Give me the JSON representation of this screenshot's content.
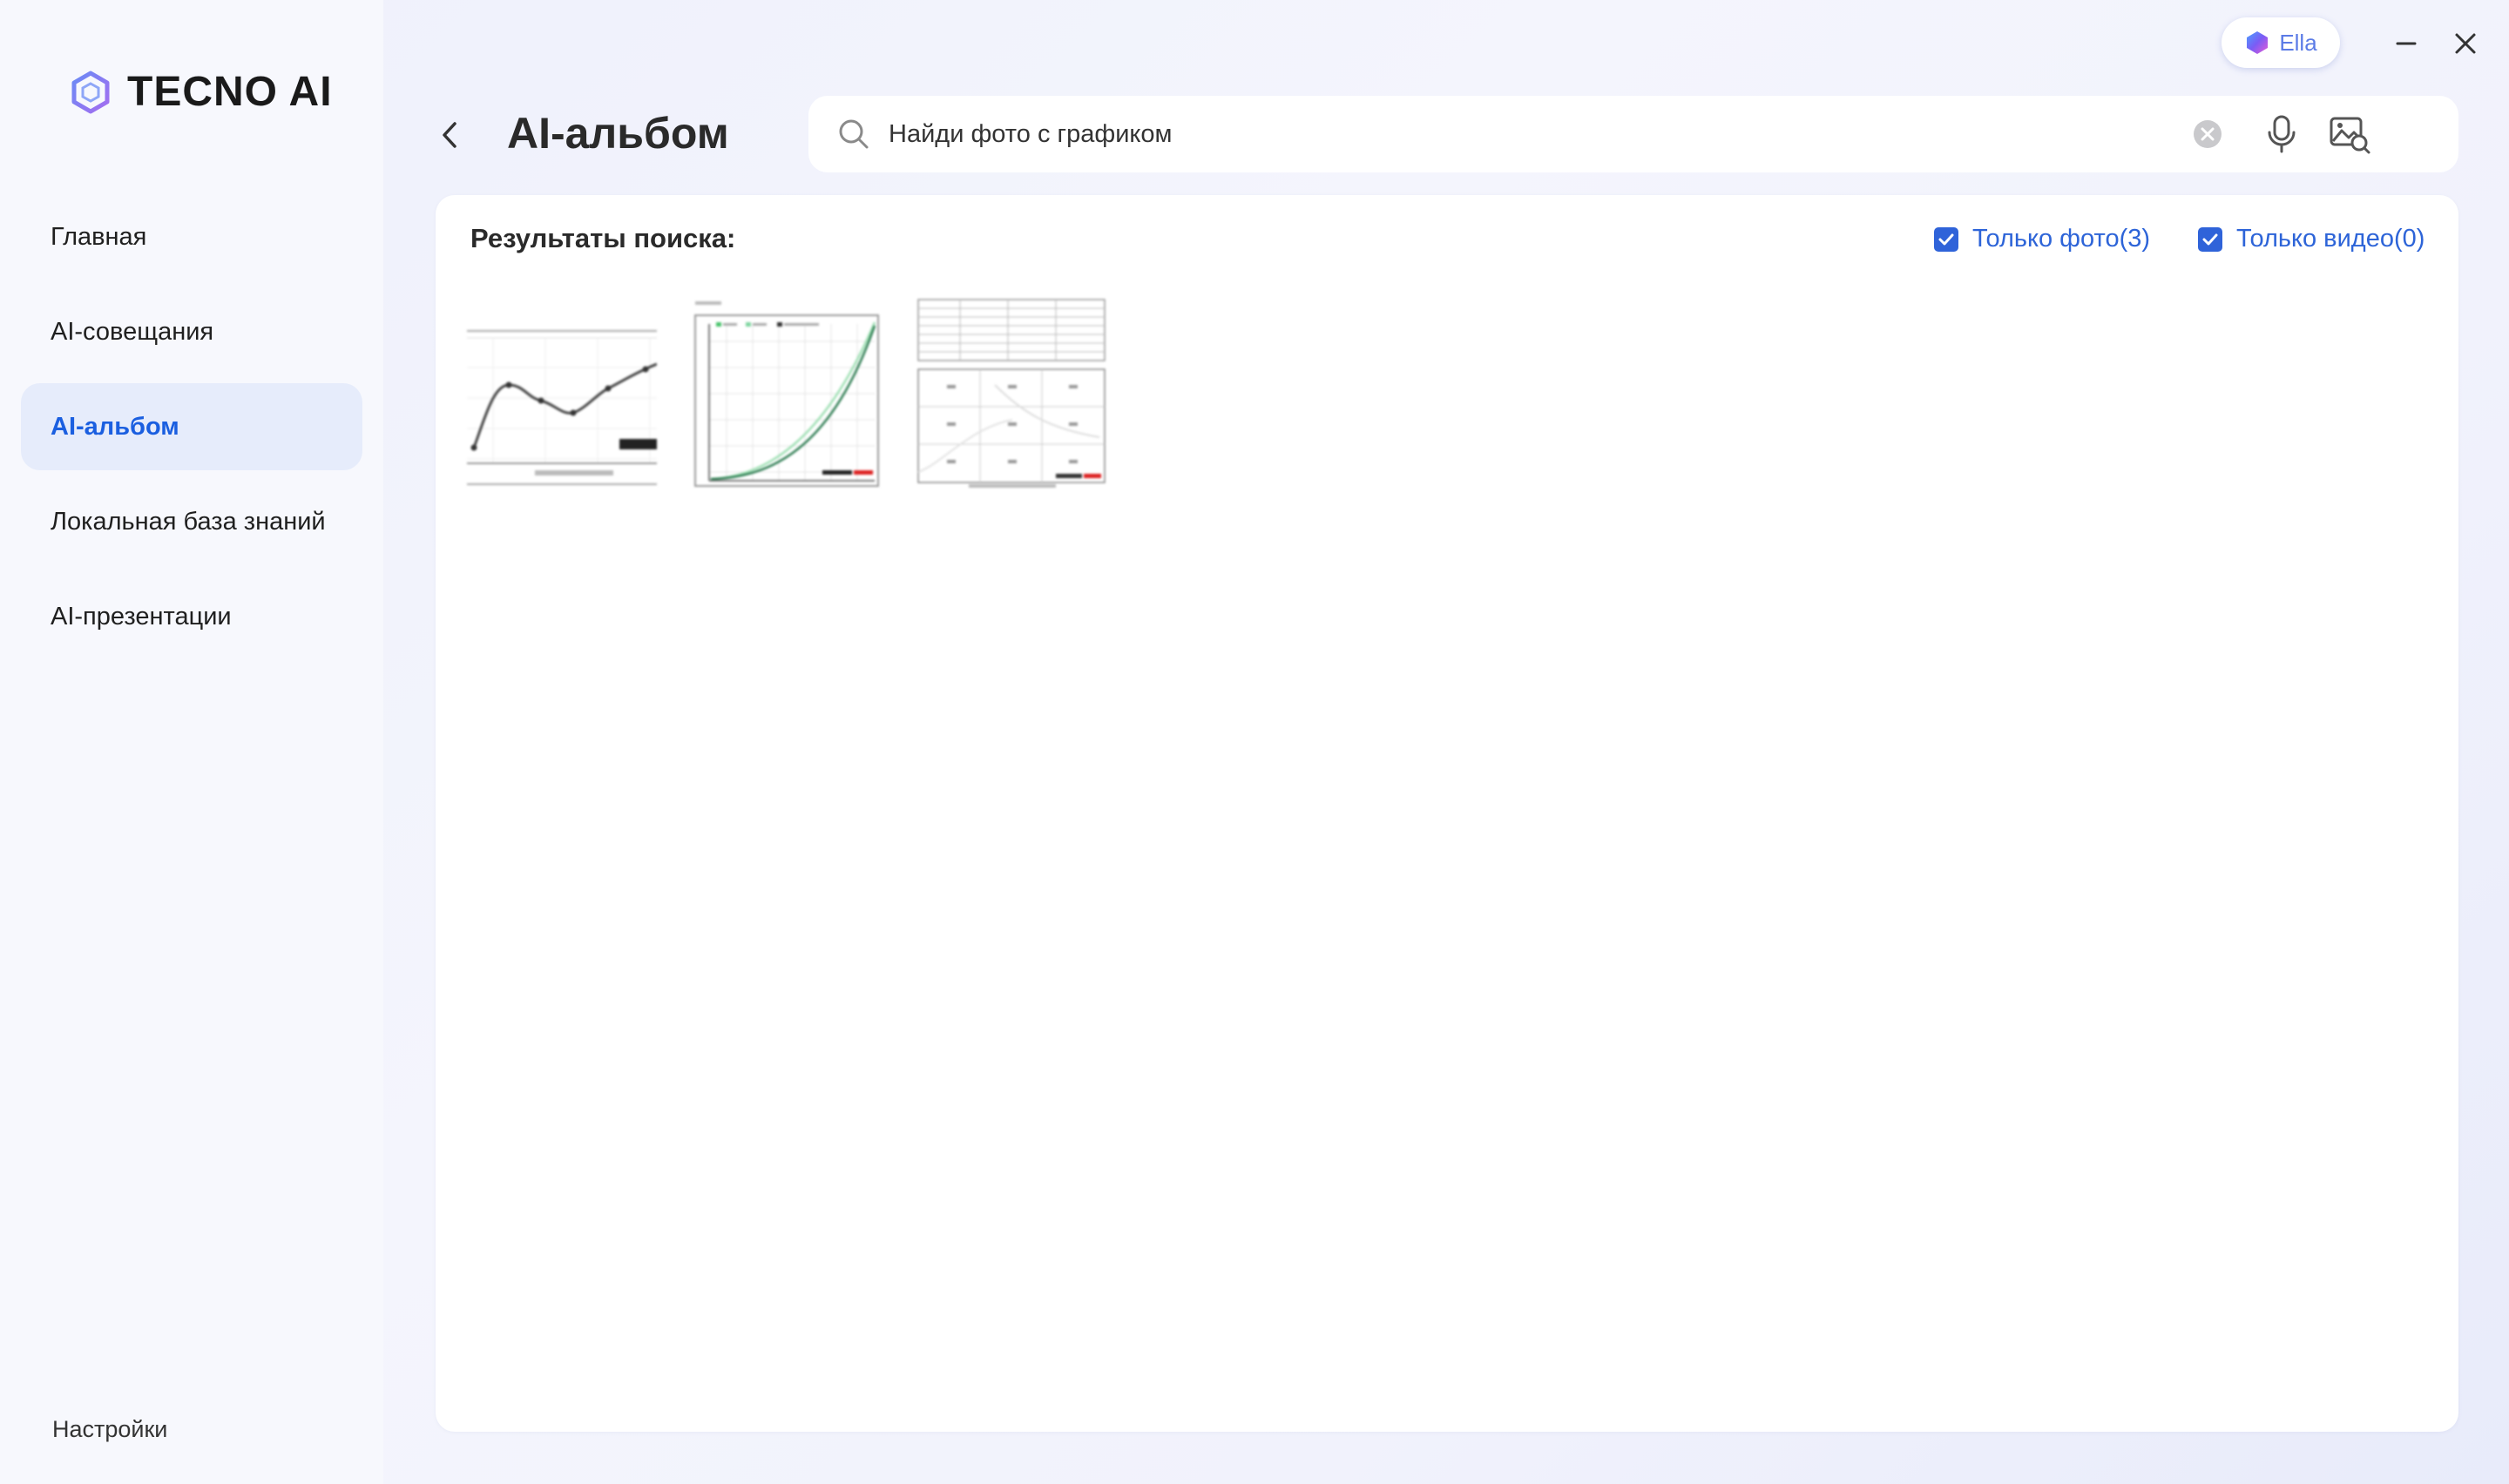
{
  "app": {
    "brand": "TECNO AI",
    "assistant_label": "Ella"
  },
  "sidebar": {
    "items": [
      {
        "label": "Главная",
        "active": false
      },
      {
        "label": "AI-совещания",
        "active": false
      },
      {
        "label": "AI-альбом",
        "active": true
      },
      {
        "label": "Локальная база знаний",
        "active": false
      },
      {
        "label": "AI-презентации",
        "active": false
      }
    ],
    "settings_label": "Настройки"
  },
  "header": {
    "title": "AI-альбом"
  },
  "search": {
    "value": "Найди фото с графиком",
    "placeholder": ""
  },
  "results": {
    "title": "Результаты поиска:",
    "filters": [
      {
        "label": "Только фото(3)",
        "checked": true
      },
      {
        "label": "Только видео(0)",
        "checked": true
      }
    ],
    "thumbnails": [
      {
        "kind": "line-chart-photo"
      },
      {
        "kind": "curve-chart-photo"
      },
      {
        "kind": "table-photo"
      }
    ]
  },
  "colors": {
    "accent": "#2f63d9",
    "active_nav_bg": "#e6ecfb",
    "active_nav_text": "#1b5fe0"
  }
}
